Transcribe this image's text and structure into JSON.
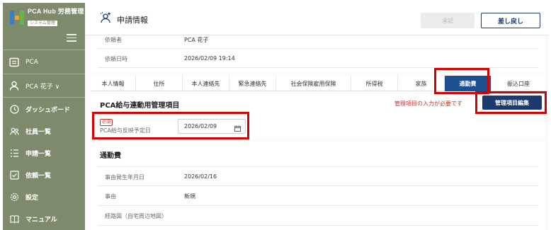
{
  "app": {
    "logo_title": "PCA Hub 労務管理",
    "logo_badge": "システム管理"
  },
  "sidebar": {
    "org": "PCA",
    "user": "PCA 花子 ∨",
    "items": [
      {
        "label": "ダッシュボード",
        "icon": "clock-icon"
      },
      {
        "label": "社員一覧",
        "icon": "people-icon"
      },
      {
        "label": "申請一覧",
        "icon": "list-icon"
      },
      {
        "label": "依頼一覧",
        "icon": "checkbox-icon"
      },
      {
        "label": "設定",
        "icon": "gear-icon"
      },
      {
        "label": "マニュアル",
        "icon": "book-icon"
      }
    ]
  },
  "header": {
    "title": "申請情報",
    "approve_label": "承認",
    "reject_label": "差し戻し"
  },
  "request_info": {
    "requester_label": "依頼者",
    "requester_value": "PCA 花子",
    "datetime_label": "依頼日時",
    "datetime_value": "2026/02/09 19:14"
  },
  "tabs": [
    {
      "label": "本人情報",
      "active": false
    },
    {
      "label": "住所",
      "active": false
    },
    {
      "label": "本人連絡先",
      "active": false
    },
    {
      "label": "緊急連絡先",
      "active": false
    },
    {
      "label": "社会保険雇用保険",
      "active": false
    },
    {
      "label": "所得税",
      "active": false
    },
    {
      "label": "家族",
      "active": false
    },
    {
      "label": "通勤費",
      "active": true
    },
    {
      "label": "振込口座",
      "active": false
    }
  ],
  "management": {
    "title": "PCA給与連動用管理項目",
    "warning": "管理項目の入力が必要です",
    "edit_button": "管理項目編集",
    "required_badge": "必須",
    "field_label": "PCA給与反映予定日",
    "field_value": "2026/02/09"
  },
  "commute": {
    "title": "通勤費",
    "rows": [
      {
        "label": "事由発生年月日",
        "value": "2026/02/16"
      },
      {
        "label": "事由",
        "value": "新規"
      },
      {
        "label": "経路図（自宅周辺地図）",
        "value": ""
      }
    ]
  },
  "colors": {
    "sidebar": "#7e8a6c",
    "primary": "#1d3a6e",
    "active_tab": "#1d4f91",
    "highlight": "#d60000",
    "warning_text": "#c0392b"
  }
}
